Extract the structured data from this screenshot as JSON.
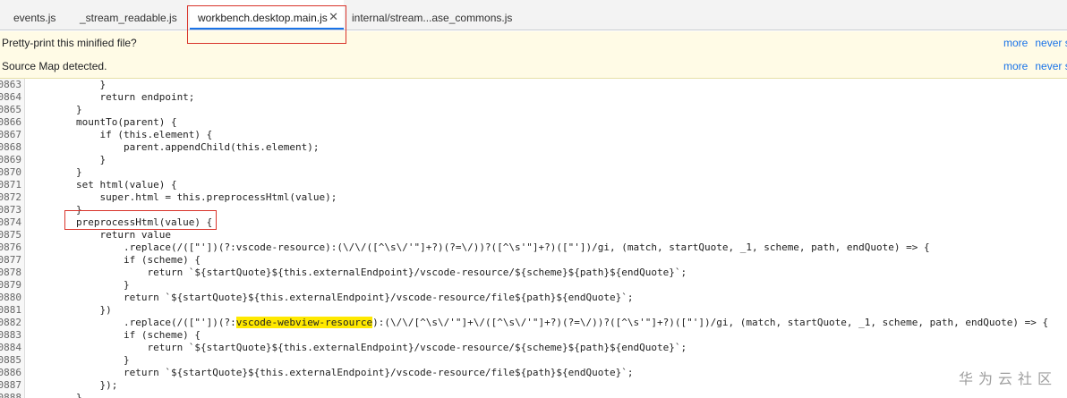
{
  "tabs": {
    "items": [
      {
        "label": "events.js"
      },
      {
        "label": "_stream_readable.js"
      },
      {
        "label": "workbench.desktop.main.js"
      },
      {
        "label": "internal/stream...ase_commons.js"
      }
    ],
    "active_close": "✕"
  },
  "infobars": [
    {
      "message": "Pretty-print this minified file?",
      "more": "more",
      "never": "never s"
    },
    {
      "message": "Source Map detected.",
      "more": "more",
      "never": "never s"
    }
  ],
  "code": {
    "lines": [
      {
        "num": "0863",
        "text": "            }"
      },
      {
        "num": "0864",
        "text": "            return endpoint;"
      },
      {
        "num": "0865",
        "text": "        }"
      },
      {
        "num": "0866",
        "text": "        mountTo(parent) {"
      },
      {
        "num": "0867",
        "text": "            if (this.element) {"
      },
      {
        "num": "0868",
        "text": "                parent.appendChild(this.element);"
      },
      {
        "num": "0869",
        "text": "            }"
      },
      {
        "num": "0870",
        "text": "        }"
      },
      {
        "num": "0871",
        "text": "        set html(value) {"
      },
      {
        "num": "0872",
        "text": "            super.html = this.preprocessHtml(value);"
      },
      {
        "num": "0873",
        "text": "        }"
      },
      {
        "num": "0874",
        "text": "        preprocessHtml(value) {"
      },
      {
        "num": "0875",
        "text": "            return value"
      },
      {
        "num": "0876",
        "text": "                .replace(/([\"'])(?:vscode-resource):(\\/\\/([^\\s\\/'\"]+?)(?=\\/))?([^\\s'\"]+?)([\"'])/gi, (match, startQuote, _1, scheme, path, endQuote) => {"
      },
      {
        "num": "0877",
        "text": "                if (scheme) {"
      },
      {
        "num": "0878",
        "text": "                    return `${startQuote}${this.externalEndpoint}/vscode-resource/${scheme}${path}${endQuote}`;"
      },
      {
        "num": "0879",
        "text": "                }"
      },
      {
        "num": "0880",
        "text": "                return `${startQuote}${this.externalEndpoint}/vscode-resource/file${path}${endQuote}`;"
      },
      {
        "num": "0881",
        "text": "            })"
      },
      {
        "num": "0882",
        "pre": "                .replace(/([\"'])(?:",
        "mark": "vscode-webview-resource",
        "post": "):(\\/\\/[^\\s\\/'\"]+\\/([^\\s\\/'\"]+?)(?=\\/))?([^\\s'\"]+?)([\"'])/gi, (match, startQuote, _1, scheme, path, endQuote) => {"
      },
      {
        "num": "0883",
        "text": "                if (scheme) {"
      },
      {
        "num": "0884",
        "text": "                    return `${startQuote}${this.externalEndpoint}/vscode-resource/${scheme}${path}${endQuote}`;"
      },
      {
        "num": "0885",
        "text": "                }"
      },
      {
        "num": "0886",
        "text": "                return `${startQuote}${this.externalEndpoint}/vscode-resource/file${path}${endQuote}`;"
      },
      {
        "num": "0887",
        "text": "            });"
      },
      {
        "num": "0888",
        "text": "        }"
      }
    ]
  },
  "watermark": "华为云社区",
  "colors": {
    "accent": "#1a73e8",
    "highlight": "#ffe900",
    "annotation": "#d9342b"
  }
}
